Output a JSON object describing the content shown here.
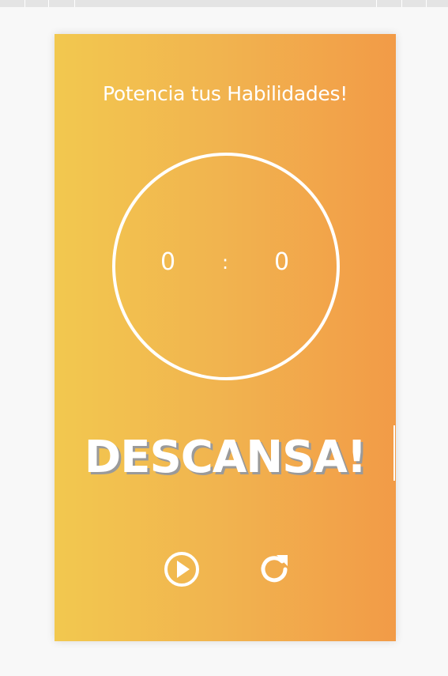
{
  "app": {
    "title": "Potencia tus Habilidades!"
  },
  "timer": {
    "minutes": "0",
    "separator": ":",
    "seconds": "0"
  },
  "status": {
    "label": "DESCANSA!"
  },
  "controls": {
    "play_icon": "play-circle-icon",
    "reset_icon": "refresh-icon"
  },
  "colors": {
    "gradient_start": "#f2c84f",
    "gradient_end": "#f29b47",
    "foreground": "#ffffff"
  }
}
